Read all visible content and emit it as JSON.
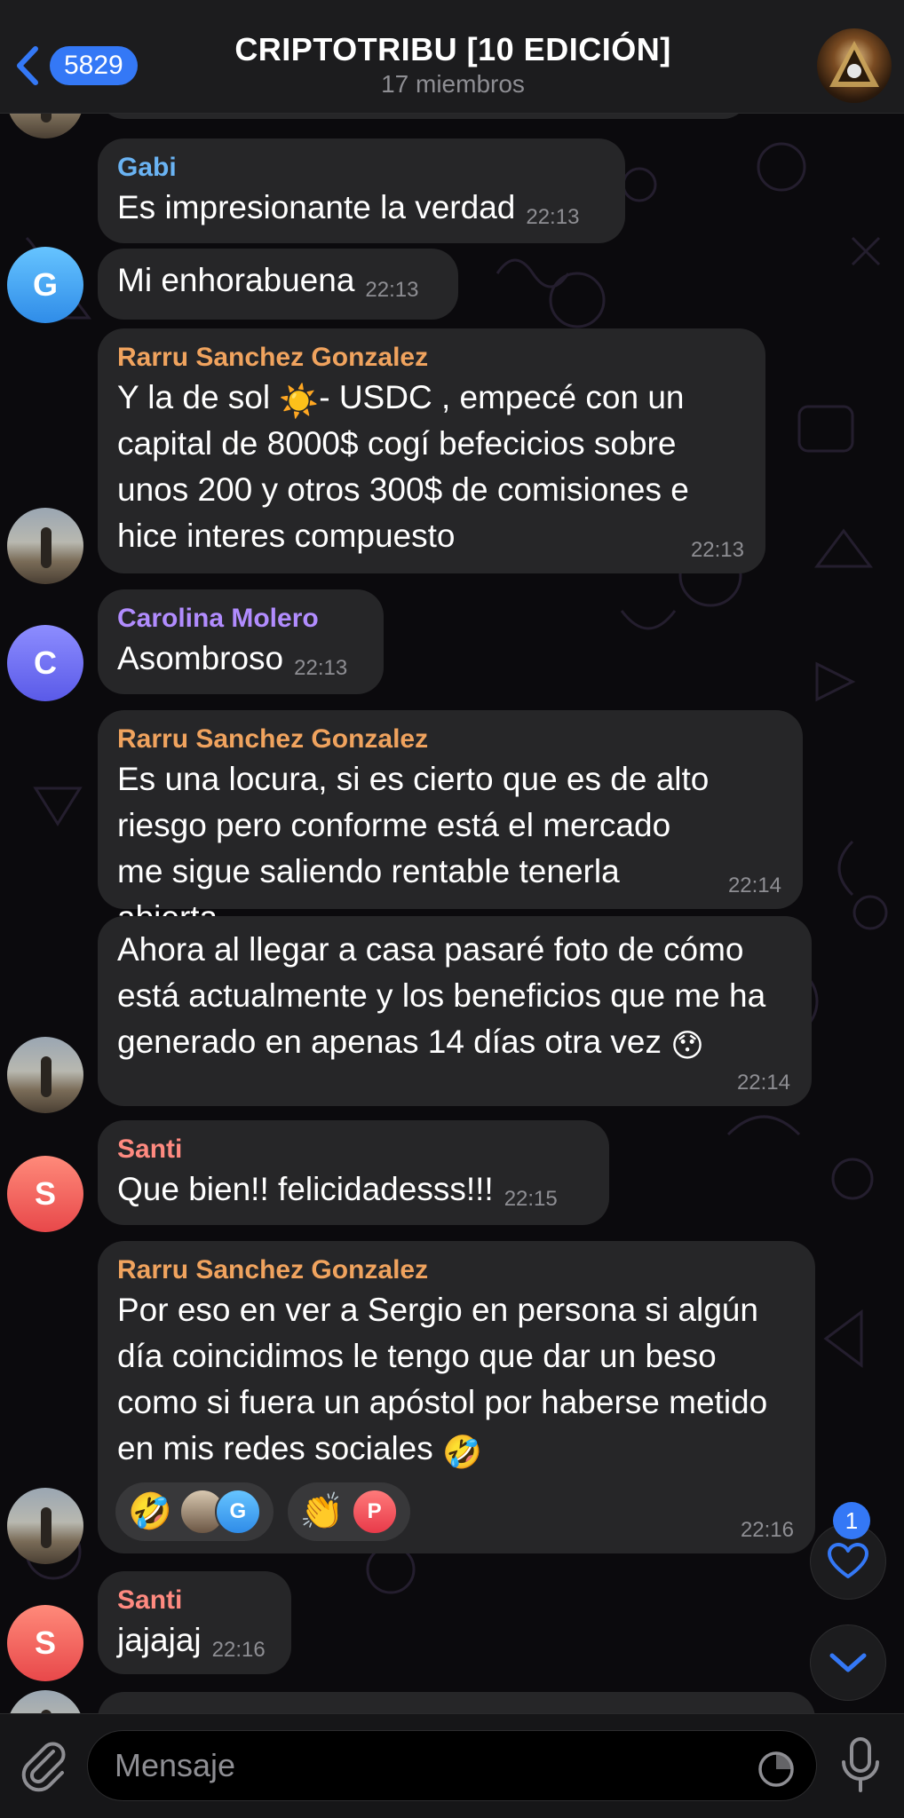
{
  "header": {
    "back_count": "5829",
    "title": "CRIPTOTRIBU [10 EDICIÓN]",
    "subtitle": "17 miembros"
  },
  "messages": [
    {
      "sender": "Gabi",
      "sender_color": "#6ab3f3",
      "text": "Es impresionante la verdad",
      "time": "22:13"
    },
    {
      "text": "Mi enhorabuena",
      "time": "22:13",
      "avatar_initial": "G"
    },
    {
      "sender": "Rarru Sanchez Gonzalez",
      "sender_color": "#f0a35e",
      "text_before_emoji": "Y la de sol ",
      "emoji": "☀️",
      "text_after_emoji": "- USDC , empecé con un capital de 8000$ cogí befecicios sobre unos 200 y otros 300$ de comisiones e hice interes compuesto",
      "time": "22:13"
    },
    {
      "sender": "Carolina Molero",
      "sender_color": "#b18cfe",
      "text": "Asombroso",
      "time": "22:13",
      "avatar_initial": "C"
    },
    {
      "sender": "Rarru Sanchez Gonzalez",
      "sender_color": "#f0a35e",
      "text": "Es una locura, si es cierto que es de alto riesgo pero conforme está el mercado me sigue saliendo rentable tenerla abierta",
      "time": "22:14"
    },
    {
      "text": "Ahora al llegar a casa pasaré foto de cómo está actualmente y los beneficios que me ha generado en apenas 14 días otra vez ",
      "emoji": "😯",
      "time": "22:14"
    },
    {
      "sender": "Santi",
      "sender_color": "#ff8a80",
      "text": "Que bien!! felicidadesss!!!",
      "time": "22:15",
      "avatar_initial": "S"
    },
    {
      "sender": "Rarru Sanchez Gonzalez",
      "sender_color": "#f0a35e",
      "text": "Por eso en ver a Sergio en persona si algún día coincidimos le tengo que dar un beso como si fuera un apóstol por haberse metido en mis redes sociales ",
      "emoji": "🤣",
      "time": "22:16",
      "reactions": [
        {
          "emoji": "🤣",
          "mini_initial": "G"
        },
        {
          "emoji": "👏",
          "mini_initial": "P"
        }
      ]
    },
    {
      "sender": "Santi",
      "sender_color": "#ff8a80",
      "text": "jajajaj",
      "time": "22:16",
      "avatar_initial": "S"
    }
  ],
  "floating": {
    "heart_badge": "1"
  },
  "input": {
    "placeholder": "Mensaje"
  },
  "icons": {
    "back": "chevron-left-icon",
    "attach": "paperclip-icon",
    "sticker": "sticker-icon",
    "mic": "microphone-icon",
    "heart": "heart-icon",
    "scroll_down": "chevron-down-icon"
  },
  "colors": {
    "accent": "#3478f6",
    "bubble": "#262628",
    "header": "#1c1c1e"
  }
}
